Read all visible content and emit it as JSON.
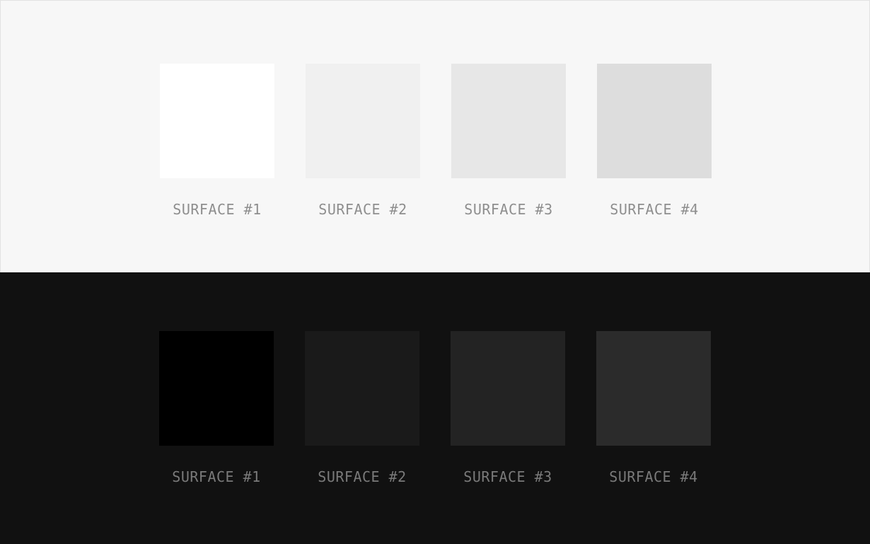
{
  "light": {
    "background": "#f7f7f7",
    "label_color": "#8e8e8e",
    "swatches": [
      {
        "label": "SURFACE #1",
        "color": "#ffffff"
      },
      {
        "label": "SURFACE #2",
        "color": "#f0f0f0"
      },
      {
        "label": "SURFACE #3",
        "color": "#e7e7e7"
      },
      {
        "label": "SURFACE #4",
        "color": "#dddddd"
      }
    ]
  },
  "dark": {
    "background": "#111111",
    "label_color": "#7a7a7a",
    "swatches": [
      {
        "label": "SURFACE #1",
        "color": "#000000"
      },
      {
        "label": "SURFACE #2",
        "color": "#1a1a1a"
      },
      {
        "label": "SURFACE #3",
        "color": "#232323"
      },
      {
        "label": "SURFACE #4",
        "color": "#2b2b2b"
      }
    ]
  }
}
